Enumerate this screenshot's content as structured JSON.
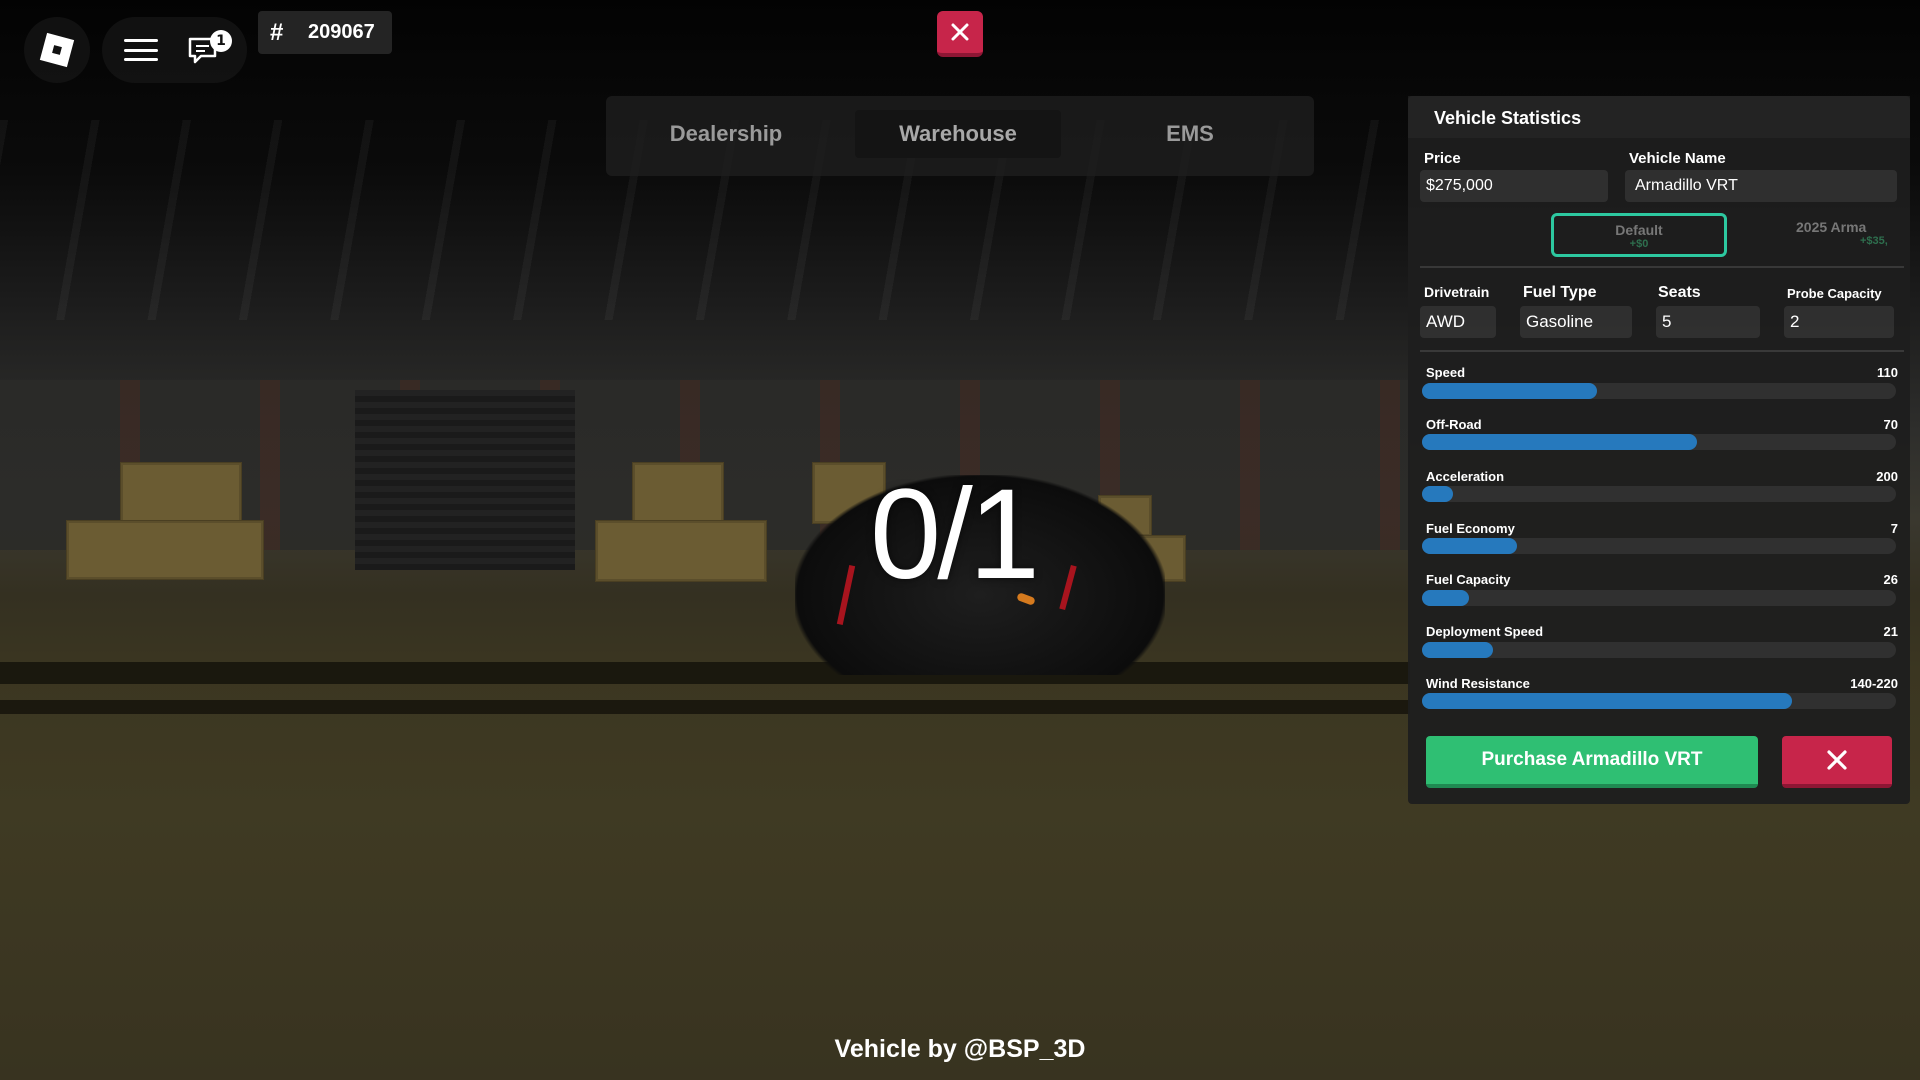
{
  "hud": {
    "chat_badge_count": "1",
    "server_hash": "#",
    "server_number": "209067"
  },
  "tabs": [
    {
      "label": "Dealership",
      "active": false
    },
    {
      "label": "Warehouse",
      "active": true
    },
    {
      "label": "EMS",
      "active": false
    }
  ],
  "viewport": {
    "counter": "0/1",
    "credit": "Vehicle by @BSP_3D"
  },
  "panel": {
    "title": "Vehicle Statistics",
    "price_label": "Price",
    "price_value": "$275,000",
    "name_label": "Vehicle Name",
    "name_value": "Armadillo VRT",
    "variants": [
      {
        "name": "Default",
        "price": "+$0",
        "selected": true
      },
      {
        "name": "2025 Arma",
        "price": "+$35,",
        "selected": false
      }
    ],
    "specs": [
      {
        "label": "Drivetrain",
        "value": "AWD"
      },
      {
        "label": "Fuel Type",
        "value": "Gasoline"
      },
      {
        "label": "Seats",
        "value": "5"
      },
      {
        "label": "Probe Capacity",
        "value": "2"
      }
    ],
    "stats": [
      {
        "label": "Speed",
        "value": "110",
        "fill": 0.37
      },
      {
        "label": "Off-Road",
        "value": "70",
        "fill": 0.58
      },
      {
        "label": "Acceleration",
        "value": "200",
        "fill": 0.065
      },
      {
        "label": "Fuel Economy",
        "value": "7",
        "fill": 0.2
      },
      {
        "label": "Fuel Capacity",
        "value": "26",
        "fill": 0.1
      },
      {
        "label": "Deployment Speed",
        "value": "21",
        "fill": 0.15
      },
      {
        "label": "Wind Resistance",
        "value": "140-220",
        "fill": 0.78
      }
    ],
    "purchase_label": "Purchase Armadillo VRT"
  },
  "colors": {
    "accent_green": "#2fbf73",
    "close_red": "#c7254a",
    "bar_blue": "#2679bd",
    "selected_outline": "#2dc8a0"
  }
}
